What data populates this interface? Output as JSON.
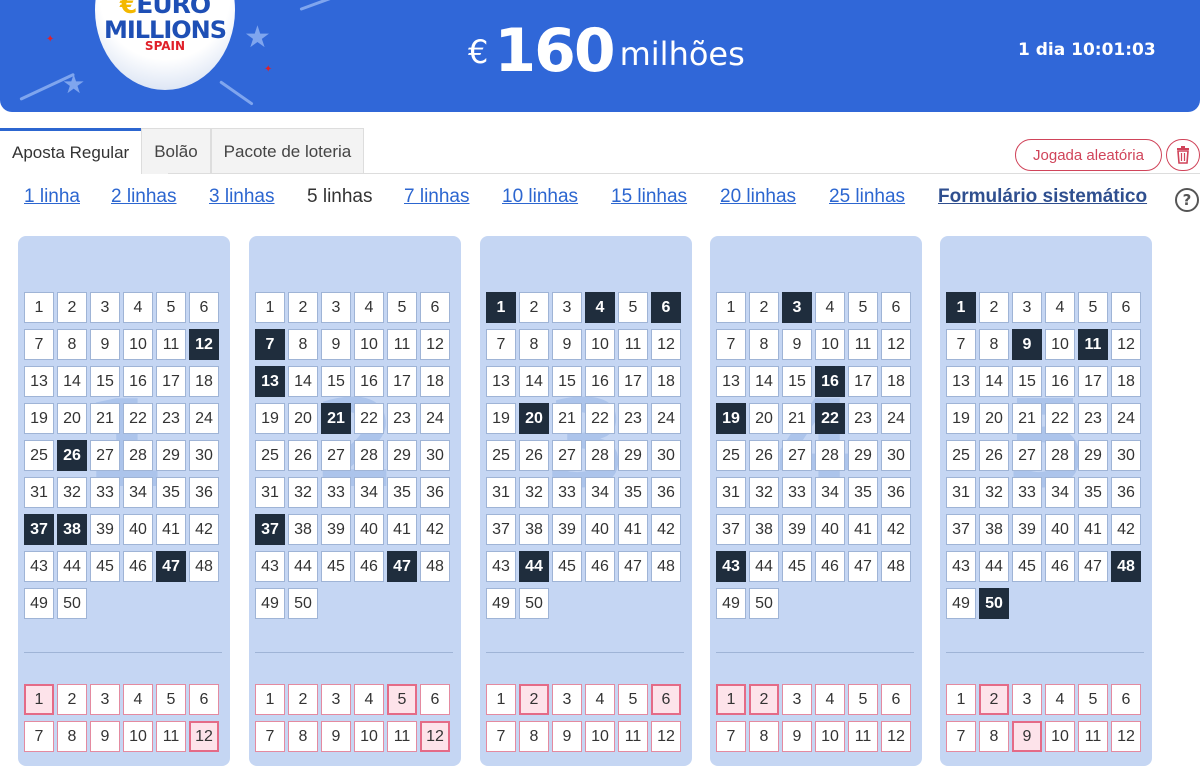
{
  "header": {
    "logo": {
      "euro": "EURO",
      "millions": "MILLIONS",
      "spain": "SPAIN"
    },
    "jackpot": {
      "currency": "€",
      "amount": "160",
      "unit": "milhões"
    },
    "countdown": "1 dia 10:01:03"
  },
  "tabs": [
    "Aposta Regular",
    "Bolão",
    "Pacote de loteria"
  ],
  "active_tab": 0,
  "actions": {
    "random_label": "Jogada aleatória",
    "trash_icon": "trash-icon"
  },
  "line_options": [
    "1 linha",
    "2 linhas",
    "3 linhas",
    "5 linhas",
    "7 linhas",
    "10 linhas",
    "15 linhas",
    "20 linhas",
    "25 linhas",
    "Formulário sistemático"
  ],
  "selected_line_option": "5 linhas",
  "help_symbol": "?",
  "colors": {
    "header": "#3067d8",
    "card": "#c5d6f3",
    "selected": "#1f2d3d",
    "accent": "#d0445a",
    "link": "#2c66d0"
  },
  "cards": [
    {
      "number": "1",
      "main_selected": [
        12,
        26,
        37,
        38,
        47
      ],
      "stars_selected": [
        1,
        12
      ]
    },
    {
      "number": "2",
      "main_selected": [
        7,
        13,
        21,
        37,
        47
      ],
      "stars_selected": [
        5,
        12
      ]
    },
    {
      "number": "3",
      "main_selected": [
        1,
        4,
        6,
        20,
        44
      ],
      "stars_selected": [
        2,
        6
      ]
    },
    {
      "number": "4",
      "main_selected": [
        3,
        16,
        19,
        22,
        43
      ],
      "stars_selected": [
        1,
        2
      ]
    },
    {
      "number": "5",
      "main_selected": [
        1,
        9,
        11,
        48,
        50
      ],
      "stars_selected": [
        2,
        9
      ]
    }
  ],
  "main_numbers_max": 50,
  "visible_star_numbers": [
    1,
    2,
    3,
    4,
    5,
    6,
    7,
    8,
    9,
    10,
    11,
    12
  ]
}
